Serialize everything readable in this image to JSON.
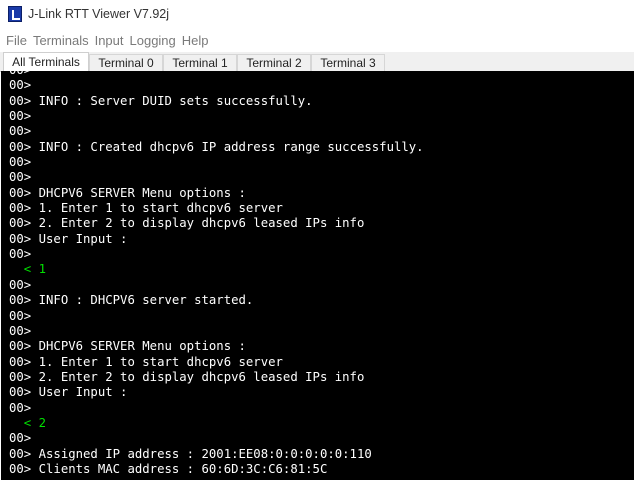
{
  "window": {
    "title": "J-Link RTT Viewer V7.92j"
  },
  "menu": [
    "File",
    "Terminals",
    "Input",
    "Logging",
    "Help"
  ],
  "tabs": [
    "All Terminals",
    "Terminal 0",
    "Terminal 1",
    "Terminal 2",
    "Terminal 3"
  ],
  "active_tab": "All Terminals",
  "terminal": {
    "lines": [
      {
        "text": "00>",
        "input": false
      },
      {
        "text": "00>",
        "input": false
      },
      {
        "text": "00> INFO : Server DUID sets successfully.",
        "input": false
      },
      {
        "text": "00>",
        "input": false
      },
      {
        "text": "00>",
        "input": false
      },
      {
        "text": "00> INFO : Created dhcpv6 IP address range successfully.",
        "input": false
      },
      {
        "text": "00>",
        "input": false
      },
      {
        "text": "00>",
        "input": false
      },
      {
        "text": "00> DHCPV6 SERVER Menu options :",
        "input": false
      },
      {
        "text": "00> 1. Enter 1 to start dhcpv6 server",
        "input": false
      },
      {
        "text": "00> 2. Enter 2 to display dhcpv6 leased IPs info",
        "input": false
      },
      {
        "text": "00> User Input :",
        "input": false
      },
      {
        "text": "00>",
        "input": false
      },
      {
        "text": "  < 1",
        "input": true
      },
      {
        "text": "00>",
        "input": false
      },
      {
        "text": "00> INFO : DHCPV6 server started.",
        "input": false
      },
      {
        "text": "00>",
        "input": false
      },
      {
        "text": "00>",
        "input": false
      },
      {
        "text": "00> DHCPV6 SERVER Menu options :",
        "input": false
      },
      {
        "text": "00> 1. Enter 1 to start dhcpv6 server",
        "input": false
      },
      {
        "text": "00> 2. Enter 2 to display dhcpv6 leased IPs info",
        "input": false
      },
      {
        "text": "00> User Input :",
        "input": false
      },
      {
        "text": "00>",
        "input": false
      },
      {
        "text": "  < 2",
        "input": true
      },
      {
        "text": "00>",
        "input": false
      },
      {
        "text": "00> Assigned IP address : 2001:EE08:0:0:0:0:0:110",
        "input": false
      },
      {
        "text": "00> Clients MAC address : 60:6D:3C:C6:81:5C",
        "input": false
      }
    ]
  },
  "colors": {
    "terminal_bg": "#000000",
    "output_text": "#ffffff",
    "input_text": "#00e000"
  }
}
